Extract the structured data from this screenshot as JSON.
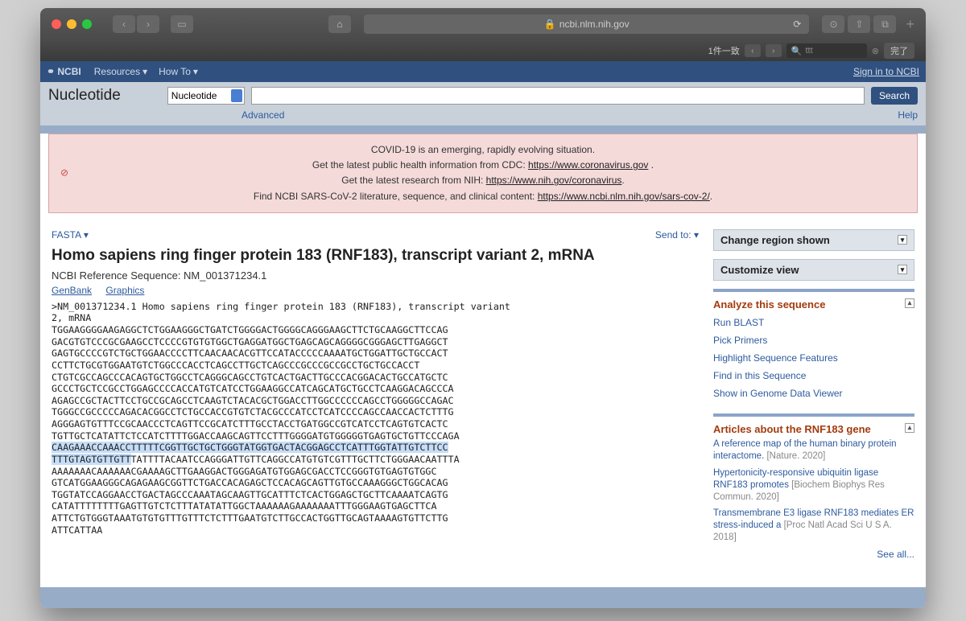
{
  "browser": {
    "url": "ncbi.nlm.nih.gov",
    "find": {
      "count": "1件一致",
      "query": "ttt",
      "done": "完了"
    }
  },
  "ncbi": {
    "logo": "NCBI",
    "resources": "Resources",
    "howto": "How To",
    "signin": "Sign in to NCBI"
  },
  "search": {
    "db_label": "Nucleotide",
    "db_selected": "Nucleotide",
    "button": "Search",
    "advanced": "Advanced",
    "help": "Help"
  },
  "alert": {
    "l1": "COVID-19 is an emerging, rapidly evolving situation.",
    "l2a": "Get the latest public health information from CDC: ",
    "l2b": "https://www.coronavirus.gov",
    "l2c": " .",
    "l3a": "Get the latest research from NIH: ",
    "l3b": "https://www.nih.gov/coronavirus",
    "l3c": ".",
    "l4a": "Find NCBI SARS-CoV-2 literature, sequence, and clinical content: ",
    "l4b": "https://www.ncbi.nlm.nih.gov/sars-cov-2/",
    "l4c": "."
  },
  "record": {
    "fasta": "FASTA",
    "sendto": "Send to:",
    "title": "Homo sapiens ring finger protein 183 (RNF183), transcript variant 2, mRNA",
    "refseq": "NCBI Reference Sequence: NM_001371234.1",
    "genbank": "GenBank",
    "graphics": "Graphics",
    "seq_before1": ">NM_001371234.1 Homo sapiens ring finger protein 183 (RNF183), transcript variant\n2, mRNA\nTGGAAGGGGAAGAGGCTCTGGAAGGGCTGATCTGGGGACTGGGGCAGGGAAGCTTCTGCAAGGCTTCCAG\nGACGTGTCCCGCGAAGCCTCCCCGTGTGTGGCTGAGGATGGCTGAGCAGCAGGGGCGGGAGCTTGAGGCT\nGAGTGCCCCGTCTGCTGGAACCCCTTCAACAACACGTTCCATACCCCCAAAATGCTGGATTGCTGCCACT\nCCTTCTGCGTGGAATGTCTGGCCCACCTCAGCCTTGCTCAGCCCGCCCGCCGCCTGCTGCCACCT\nCTGTCGCCAGCCCACAGTGCTGGCCTCAGGGCAGCCTGTCACTGACTTGCCCACGGACACTGCCATGCTC\nGCCCTGCTCCGCCTGGAGCCCCACCATGTCATCCTGGAAGGCCATCAGCATGCTGCCTCAAGGACAGCCCA\nAGAGCCGCTACTTCCTGCCGCAGCCTCAAGTCTACACGCTGGACCTTGGCCCCCCAGCCTGGGGGCCAGAC\nTGGGCCGCCCCCAGACACGGCCTCTGCCACCGTGTCTACGCCCATCCTCATCCCCAGCCAACCACTCTTTG\nAGGGAGTGTTTCCGCAACCCTCAGTTCCGCATCTTTGCCTACCTGATGGCCGTCATCCTCAGTGTCACTC\nTGTTGCTCATATTCTCCATCTTTTGGACCAAGCAGTTCCTTTGGGGATGTGGGGGTGAGTGCTGTTCCCAGA\n",
    "seq_hl": "CAAGAAACCAAACCTTTTTCGGTTGCTGCTGGGTATGGTGACTACGGAGCCTCATTTGGTATTGTCTTCC\nTTTGTAGTGTTGTT",
    "seq_after": "TATTTTACAATCCAGGGATTGTTCAGGCCATGTGTCGTTTGCTTCTGGGAACAATTTA\nAAAAAAACAAAAAACGAAAAGCTTGAAGGACTGGGAGATGTGGAGCGACCTCCGGGTGTGAGTGTGGC\nGTCATGGAAGGGCAGAGAAGCGGTTCTGACCACAGAGCTCCACAGCAGTTGTGCCAAAGGGCTGGCACAG\nTGGTATCCAGGAACCTGACTAGCCCAAATAGCAAGTTGCATTTCTCACTGGAGCTGCTTCAAAATCAGTG\nCATATTTTTTTTGAGTTGTCTCTTTATATATTGGCTAAAAAAGAAAAAAATTTGGGAAGTGAGCTTCA\nATTCTGTGGGTAAATGTGTGTTTGTTTCTCTTTGAATGTCTTGCCACTGGTTGCAGTAAAAGTGTTCTTG\nATTCATTAA"
  },
  "sidebar": {
    "panel1": "Change region shown",
    "panel2": "Customize view",
    "analyze": {
      "title": "Analyze this sequence",
      "links": [
        "Run BLAST",
        "Pick Primers",
        "Highlight Sequence Features",
        "Find in this Sequence",
        "Show in Genome Data Viewer"
      ]
    },
    "articles": {
      "title": "Articles about the RNF183 gene",
      "seeall": "See all...",
      "items": [
        {
          "t": "A reference map of the human binary protein interactome.",
          "c": "[Nature. 2020]"
        },
        {
          "t": "Hypertonicity-responsive ubiquitin ligase RNF183 promotes",
          "c": " [Biochem Biophys Res Commun. 2020]"
        },
        {
          "t": "Transmembrane E3 ligase RNF183 mediates ER stress-induced a",
          "c": " [Proc Natl Acad Sci U S A. 2018]"
        }
      ]
    }
  }
}
